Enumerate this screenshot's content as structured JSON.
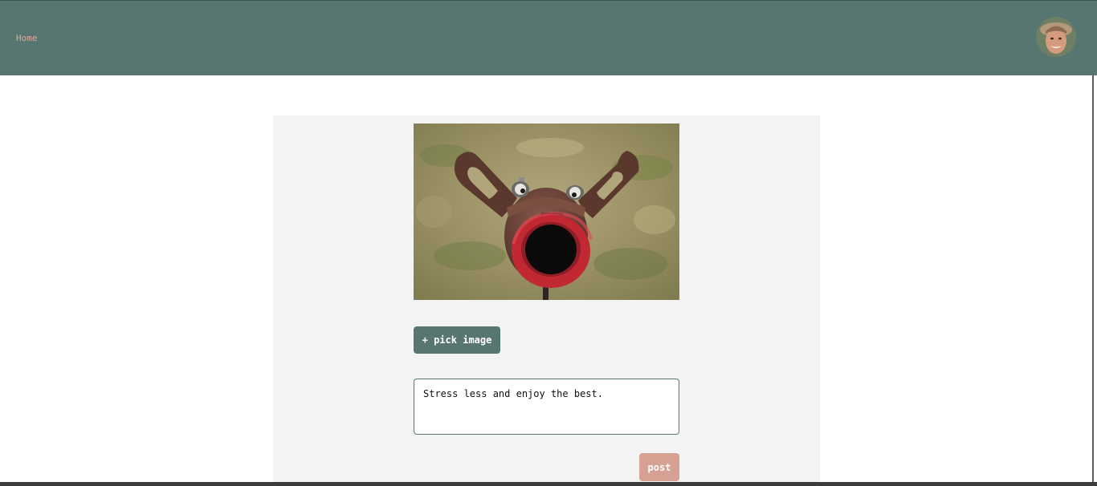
{
  "nav": {
    "home_label": "Home"
  },
  "profile": {
    "avatar_icon": "user-avatar-photo"
  },
  "composer": {
    "preview_image_icon": "uploaded-photo-preview",
    "pick_image_label": "+ pick image",
    "caption_value": "Stress less and enjoy the best.",
    "post_label": "post"
  },
  "colors": {
    "header_bg": "#577571",
    "link": "#e3a897",
    "panel_bg": "#f3f3f3",
    "primary_button": "#577571",
    "post_button": "#d6a092"
  }
}
